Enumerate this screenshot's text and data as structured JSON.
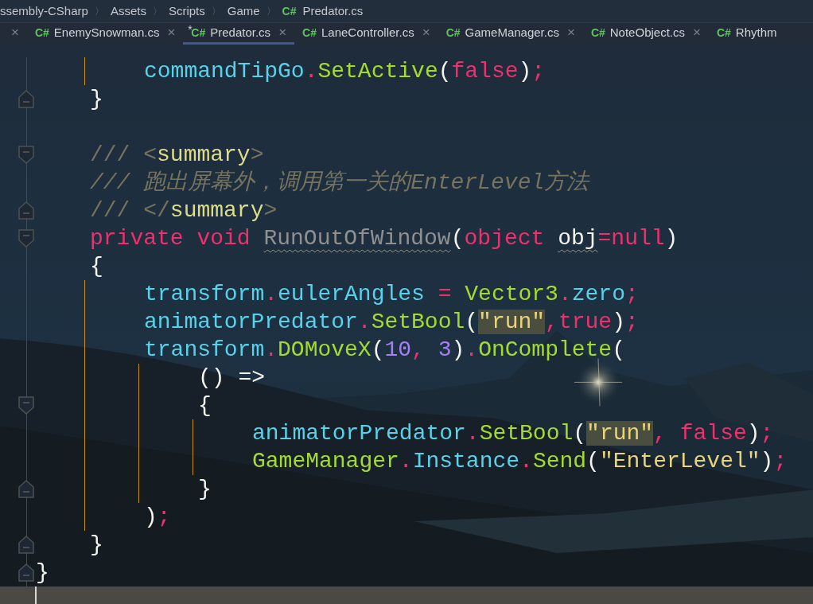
{
  "breadcrumb": [
    {
      "label": "ssembly-CSharp",
      "separator": "〉"
    },
    {
      "label": "Assets",
      "separator": "〉"
    },
    {
      "label": "Scripts",
      "separator": "〉"
    },
    {
      "label": "Game",
      "separator": "〉"
    },
    {
      "file_icon": "C#",
      "label": "Predator.cs"
    }
  ],
  "tabs": [
    {
      "close": "×",
      "selected": false
    },
    {
      "file_icon": "C#",
      "label": "EnemySnowman.cs",
      "close": "×",
      "selected": false
    },
    {
      "file_icon": "C#",
      "label": "Predator.cs",
      "close": "×",
      "selected": true,
      "modified": true,
      "modified_mark": "*"
    },
    {
      "file_icon": "C#",
      "label": "LaneController.cs",
      "close": "×",
      "selected": false
    },
    {
      "file_icon": "C#",
      "label": "GameManager.cs",
      "close": "×",
      "selected": false
    },
    {
      "file_icon": "C#",
      "label": "NoteObject.cs",
      "close": "×",
      "selected": false
    },
    {
      "file_icon": "C#",
      "label": "Rhythm",
      "selected": false
    }
  ],
  "editor": {
    "class_body": [
      {
        "kind": "continuation",
        "children": [
          {
            "tokens": [
              {
                "text": "commandTipGo",
                "kind": "ident"
              },
              {
                "text": ".",
                "kind": "keyword"
              },
              {
                "text": "SetActive",
                "kind": "method"
              },
              {
                "text": "(",
                "kind": "punct"
              },
              {
                "text": "false",
                "kind": "keyword"
              },
              {
                "text": ")",
                "kind": "punct"
              },
              {
                "text": ";",
                "kind": "keyword"
              }
            ]
          }
        ]
      },
      {
        "tokens": [
          {
            "text": "}",
            "kind": "punct"
          }
        ],
        "fold": {
          "kind": "end"
        }
      },
      {
        "kind": "blank"
      },
      {
        "tokens": [
          {
            "text": "///",
            "kind": "comment"
          },
          {
            "text": "<",
            "kind": "comment",
            "space_before": true
          },
          {
            "text": "summary",
            "kind": "doctag"
          },
          {
            "text": ">",
            "kind": "comment"
          }
        ],
        "fold": {
          "kind": "start"
        }
      },
      {
        "tokens": [
          {
            "text": "/// 跑出屏幕外，调用第一关的EnterLevel方法",
            "kind": "comment_italic"
          }
        ]
      },
      {
        "tokens": [
          {
            "text": "///",
            "kind": "comment"
          },
          {
            "text": "</",
            "kind": "comment",
            "space_before": true
          },
          {
            "text": "summary",
            "kind": "doctag"
          },
          {
            "text": ">",
            "kind": "comment"
          }
        ],
        "fold": {
          "kind": "end"
        }
      },
      {
        "tokens": [
          {
            "text": "private void",
            "kind": "keyword"
          },
          {
            "text": "RunOutOfWindow",
            "kind": "unused",
            "space_before": true
          },
          {
            "text": "(",
            "kind": "punct"
          },
          {
            "text": "object",
            "kind": "keyword"
          },
          {
            "text": "obj",
            "kind": "warned",
            "space_before": true
          },
          {
            "text": "=",
            "kind": "keyword"
          },
          {
            "text": "null",
            "kind": "keyword"
          },
          {
            "text": ")",
            "kind": "punct"
          }
        ],
        "fold": {
          "kind": "start"
        }
      },
      {
        "tokens": [
          {
            "text": "{",
            "kind": "punct"
          }
        ],
        "children": [
          {
            "tokens": [
              {
                "text": "transform",
                "kind": "ident"
              },
              {
                "text": ".",
                "kind": "keyword"
              },
              {
                "text": "eulerAngles",
                "kind": "ident"
              },
              {
                "text": "=",
                "kind": "keyword",
                "space_before": true
              },
              {
                "text": "Vector3",
                "kind": "method",
                "space_before": true
              },
              {
                "text": ".",
                "kind": "keyword"
              },
              {
                "text": "zero",
                "kind": "ident"
              },
              {
                "text": ";",
                "kind": "keyword"
              }
            ]
          },
          {
            "tokens": [
              {
                "text": "animatorPredator",
                "kind": "ident"
              },
              {
                "text": ".",
                "kind": "keyword"
              },
              {
                "text": "SetBool",
                "kind": "method"
              },
              {
                "text": "(",
                "kind": "punct"
              },
              {
                "text": "\"run\"",
                "kind": "string_highlighted"
              },
              {
                "text": ",",
                "kind": "keyword"
              },
              {
                "text": "true",
                "kind": "keyword"
              },
              {
                "text": ")",
                "kind": "punct"
              },
              {
                "text": ";",
                "kind": "keyword"
              }
            ]
          },
          {
            "tokens": [
              {
                "text": "transform",
                "kind": "ident"
              },
              {
                "text": ".",
                "kind": "keyword"
              },
              {
                "text": "DOMoveX",
                "kind": "method"
              },
              {
                "text": "(",
                "kind": "punct"
              },
              {
                "text": "10",
                "kind": "number"
              },
              {
                "text": ",",
                "kind": "keyword"
              },
              {
                "text": "3",
                "kind": "number",
                "space_before": true
              },
              {
                "text": ")",
                "kind": "punct"
              },
              {
                "text": ".",
                "kind": "keyword"
              },
              {
                "text": "OnComplete",
                "kind": "method"
              },
              {
                "text": "(",
                "kind": "punct"
              }
            ],
            "children": [
              {
                "tokens": [
                  {
                    "text": "() =>",
                    "kind": "punct"
                  }
                ]
              },
              {
                "tokens": [
                  {
                    "text": "{",
                    "kind": "punct"
                  }
                ],
                "fold": {
                  "kind": "start"
                },
                "children": [
                  {
                    "tokens": [
                      {
                        "text": "animatorPredator",
                        "kind": "ident"
                      },
                      {
                        "text": ".",
                        "kind": "keyword"
                      },
                      {
                        "text": "SetBool",
                        "kind": "method"
                      },
                      {
                        "text": "(",
                        "kind": "punct"
                      },
                      {
                        "text": "\"run\"",
                        "kind": "string_highlighted"
                      },
                      {
                        "text": ",",
                        "kind": "keyword"
                      },
                      {
                        "text": "false",
                        "kind": "keyword",
                        "space_before": true
                      },
                      {
                        "text": ")",
                        "kind": "punct"
                      },
                      {
                        "text": ";",
                        "kind": "keyword"
                      }
                    ]
                  },
                  {
                    "tokens": [
                      {
                        "text": "GameManager",
                        "kind": "method"
                      },
                      {
                        "text": ".",
                        "kind": "keyword"
                      },
                      {
                        "text": "Instance",
                        "kind": "ident"
                      },
                      {
                        "text": ".",
                        "kind": "keyword"
                      },
                      {
                        "text": "Send",
                        "kind": "method"
                      },
                      {
                        "text": "(",
                        "kind": "punct"
                      },
                      {
                        "text": "\"EnterLevel\"",
                        "kind": "string"
                      },
                      {
                        "text": ")",
                        "kind": "punct"
                      },
                      {
                        "text": ";",
                        "kind": "keyword"
                      }
                    ]
                  }
                ]
              },
              {
                "tokens": [
                  {
                    "text": "}",
                    "kind": "punct"
                  }
                ],
                "fold": {
                  "kind": "end"
                }
              }
            ]
          },
          {
            "tokens": [
              {
                "text": ")",
                "kind": "punct"
              },
              {
                "text": ";",
                "kind": "keyword"
              }
            ]
          }
        ]
      },
      {
        "tokens": [
          {
            "text": "}",
            "kind": "punct"
          }
        ],
        "fold": {
          "kind": "end"
        }
      }
    ],
    "closing": {
      "tokens": [
        {
          "text": "}",
          "kind": "punct"
        }
      ],
      "fold": {
        "kind": "end"
      }
    }
  }
}
